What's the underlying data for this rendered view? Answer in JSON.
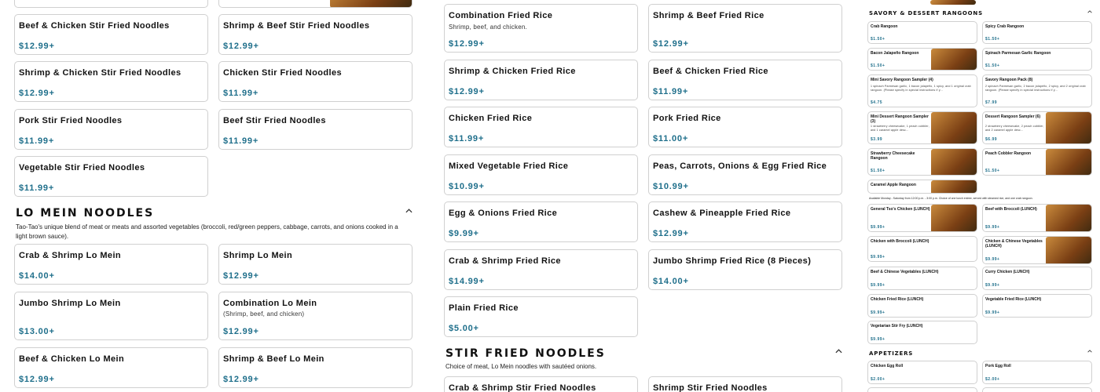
{
  "colors": {
    "price": "#1f6f8b",
    "border": "#d0d0d0"
  },
  "col1": {
    "stir_items": [
      {
        "name": "Beef & Chicken Stir Fried Noodles",
        "price": "$12.99+"
      },
      {
        "name": "Shrimp & Beef Stir Fried Noodles",
        "price": "$12.99+"
      },
      {
        "name": "Shrimp & Chicken Stir Fried Noodles",
        "price": "$12.99+"
      },
      {
        "name": "Chicken Stir Fried Noodles",
        "price": "$11.99+"
      },
      {
        "name": "Pork Stir Fried Noodles",
        "price": "$11.99+"
      },
      {
        "name": "Beef Stir Fried Noodles",
        "price": "$11.99+"
      },
      {
        "name": "Vegetable Stir Fried Noodles",
        "price": "$11.99+"
      }
    ],
    "lomein_title": "LO MEIN NOODLES",
    "lomein_desc": "Tao-Tao's unique blend of meat or meats and assorted vegetables (broccoli, red/green peppers, cabbage, carrots, and onions cooked in a light brown sauce).",
    "lomein_items": [
      {
        "name": "Crab & Shrimp Lo Mein",
        "price": "$14.00+"
      },
      {
        "name": "Shrimp Lo Mein",
        "price": "$12.99+"
      },
      {
        "name": "Jumbo Shrimp Lo Mein",
        "price": "$13.00+"
      },
      {
        "name": "Combination Lo Mein",
        "desc": "(Shrimp, beef, and chicken)",
        "price": "$12.99+"
      },
      {
        "name": "Beef & Chicken Lo Mein",
        "price": "$12.99+"
      },
      {
        "name": "Shrimp & Beef Lo Mein",
        "price": "$12.99+"
      }
    ]
  },
  "col2": {
    "rice_items": [
      {
        "name": "Combination Fried Rice",
        "desc": "Shrimp, beef, and chicken.",
        "price": "$12.99+"
      },
      {
        "name": "Shrimp & Beef Fried Rice",
        "price": "$12.99+"
      },
      {
        "name": "Shrimp & Chicken Fried Rice",
        "price": "$12.99+"
      },
      {
        "name": "Beef & Chicken Fried Rice",
        "price": "$11.99+"
      },
      {
        "name": "Chicken Fried Rice",
        "price": "$11.99+"
      },
      {
        "name": "Pork Fried Rice",
        "price": "$11.00+"
      },
      {
        "name": "Mixed Vegetable Fried Rice",
        "price": "$10.99+"
      },
      {
        "name": "Peas, Carrots, Onions & Egg Fried Rice",
        "price": "$10.99+"
      },
      {
        "name": "Egg & Onions Fried Rice",
        "price": "$9.99+"
      },
      {
        "name": "Cashew & Pineapple Fried Rice",
        "price": "$12.99+"
      },
      {
        "name": "Crab & Shrimp Fried Rice",
        "price": "$14.99+"
      },
      {
        "name": "Jumbo Shrimp Fried Rice (8 Pieces)",
        "price": "$14.00+"
      },
      {
        "name": "Plain Fried Rice",
        "price": "$5.00+"
      }
    ],
    "stir_title": "STIR FRIED NOODLES",
    "stir_desc": "Choice of meat, Lo Mein noodles with sautéed onions.",
    "stir_items": [
      {
        "name": "Crab & Shrimp Stir Fried Noodles"
      },
      {
        "name": "Shrimp Stir Fried Noodles"
      }
    ]
  },
  "col3": {
    "rangoon_title": "SAVORY & DESSERT RANGOONS",
    "rangoons": [
      {
        "name": "Crab Rangoon",
        "price": "$1.50+"
      },
      {
        "name": "Spicy Crab Rangoon",
        "price": "$1.50+"
      },
      {
        "name": "Bacon Jalapeño Rangoon",
        "price": "$1.50+"
      },
      {
        "name": "Spinach Parmesan Garlic Rangoon",
        "price": "$1.50+"
      },
      {
        "name": "Mini Savory Rangoon Sampler (4)",
        "desc": "1 spinach Parmesan garlic, 1 bacon jalapeño, 1 spicy, and 1 original crab rangoon. (Please specify in special instructions if y...",
        "price": "$4.75"
      },
      {
        "name": "Savory Rangoon Pack (8)",
        "desc": "2 spinach Parmesan garlic, 2 bacon jalapeño, 2 spicy, and 2 original crab rangoon. (Please specify in special instructions if y...",
        "price": "$7.99"
      },
      {
        "name": "Mini Dessert Rangoon Sampler (3)",
        "desc": "1 strawberry cheesecake, 1 peach cobbler, and 1 caramel apple desc...",
        "price": "$3.99"
      },
      {
        "name": "Dessert Rangoon Sampler (6)",
        "desc": "2 strawberry cheesecake, 2 peach cobbler, and 2 caramel apple desc...",
        "price": "$6.99"
      },
      {
        "name": "Strawberry Cheesecake Rangoon",
        "price": "$1.50+"
      },
      {
        "name": "Peach Cobbler Rangoon",
        "price": "$1.50+"
      },
      {
        "name": "Caramel Apple Rangoon",
        "price": ""
      }
    ],
    "lunch_note": "Available Monday - Saturday from 12:00 p.m. - 3:00 p.m. Choice of one lunch entree, served with steamed rice, and one crab rangoon.",
    "lunch": [
      {
        "name": "General Tso's Chicken (LUNCH)",
        "price": "$9.99+"
      },
      {
        "name": "Beef with Broccoli (LUNCH)",
        "price": "$9.99+"
      },
      {
        "name": "Chicken with Broccoli (LUNCH)",
        "price": "$9.99+"
      },
      {
        "name": "Chicken & Chinese Vegetables (LUNCH)",
        "price": "$9.99+"
      },
      {
        "name": "Beef & Chinese Vegetables (LUNCH)",
        "price": "$9.99+"
      },
      {
        "name": "Curry Chicken (LUNCH)",
        "price": "$9.99+"
      },
      {
        "name": "Chicken Fried Rice (LUNCH)",
        "price": "$9.99+"
      },
      {
        "name": "Vegetable Fried Rice (LUNCH)",
        "price": "$9.99+"
      },
      {
        "name": "Vegetarian Stir Fry (LUNCH)",
        "price": "$9.99+"
      }
    ],
    "appetizers_title": "APPETIZERS",
    "appetizers": [
      {
        "name": "Chicken Egg Roll",
        "price": "$2.00+"
      },
      {
        "name": "Pork Egg Roll",
        "price": "$2.00+"
      }
    ]
  }
}
